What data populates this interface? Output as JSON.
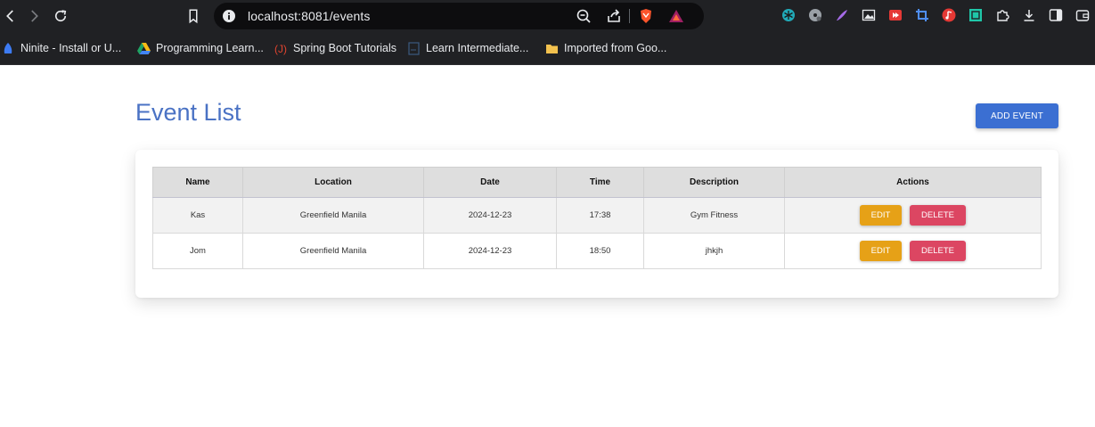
{
  "browser": {
    "url": "localhost:8081/events",
    "bookmarks": [
      {
        "label": "Ninite - Install or U...",
        "icon": "ninite-icon"
      },
      {
        "label": "Programming Learn...",
        "icon": "google-drive-icon"
      },
      {
        "label": "Spring Boot Tutorials",
        "icon": "javatpoint-icon"
      },
      {
        "label": "Learn Intermediate...",
        "icon": "page-icon"
      },
      {
        "label": "Imported from Goo...",
        "icon": "folder-icon"
      }
    ]
  },
  "page": {
    "title": "Event List",
    "add_button": "ADD EVENT"
  },
  "table": {
    "headers": [
      "Name",
      "Location",
      "Date",
      "Time",
      "Description",
      "Actions"
    ],
    "rows": [
      {
        "name": "Kas",
        "location": "Greenfield Manila",
        "date": "2024-12-23",
        "time": "17:38",
        "description": "Gym Fitness",
        "edit": "EDIT",
        "delete": "DELETE"
      },
      {
        "name": "Jom",
        "location": "Greenfield Manila",
        "date": "2024-12-23",
        "time": "18:50",
        "description": "jhkjh",
        "edit": "EDIT",
        "delete": "DELETE"
      }
    ]
  },
  "colors": {
    "title": "#4a72c4",
    "add_button": "#3b6fd2",
    "edit_button": "#e6a117",
    "delete_button": "#dc4662",
    "chrome": "#202124"
  }
}
